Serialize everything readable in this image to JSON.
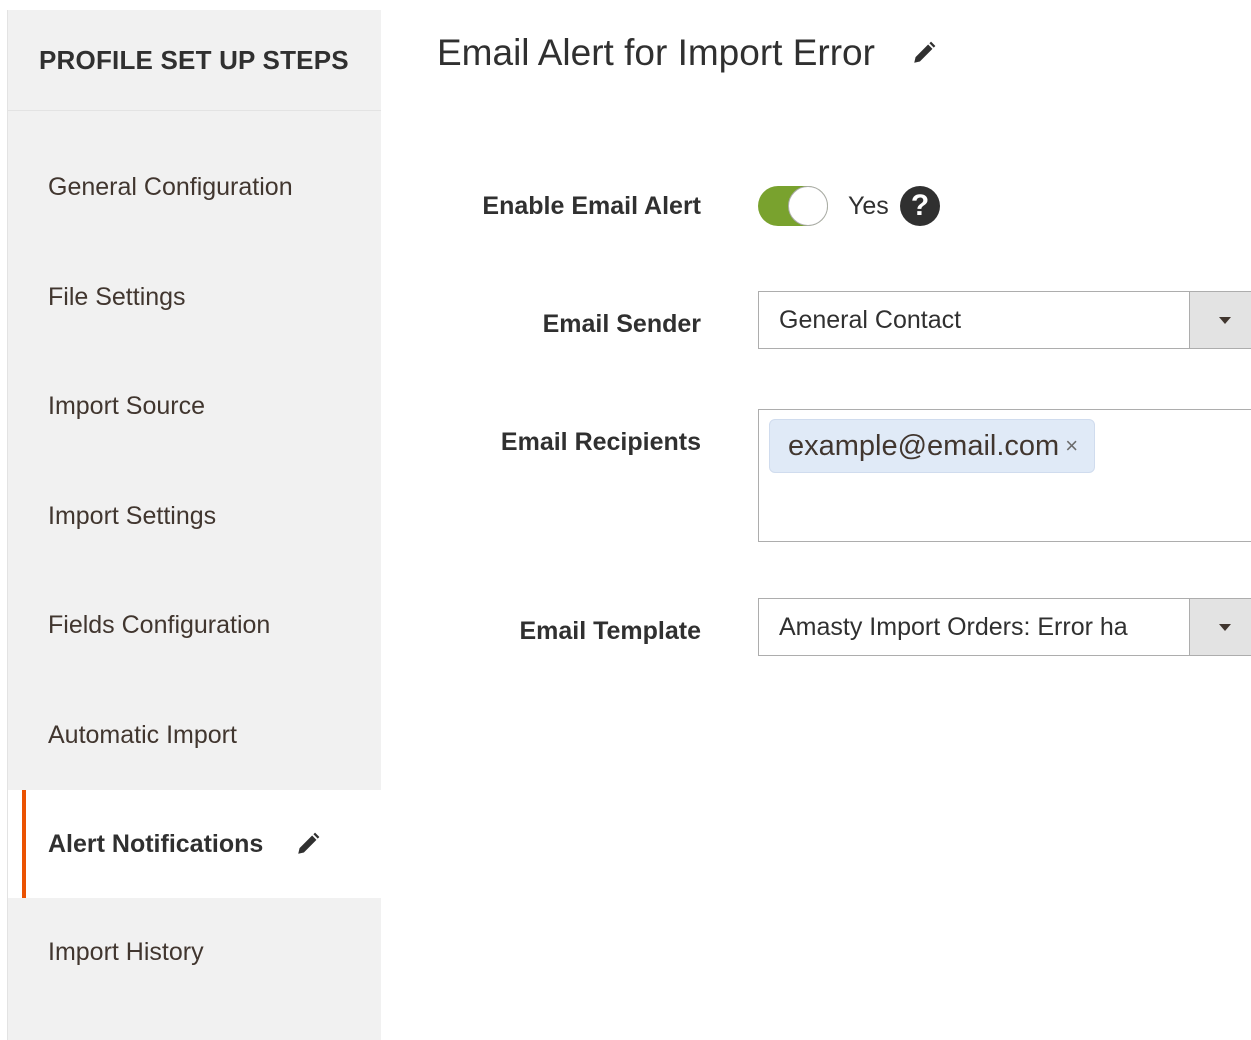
{
  "sidebar": {
    "title": "PROFILE SET UP STEPS",
    "items": [
      {
        "label": "General Configuration"
      },
      {
        "label": "File Settings"
      },
      {
        "label": "Import Source"
      },
      {
        "label": "Import Settings"
      },
      {
        "label": "Fields Configuration"
      },
      {
        "label": "Automatic Import"
      },
      {
        "label": "Alert Notifications",
        "active": true
      },
      {
        "label": "Import History"
      }
    ]
  },
  "main": {
    "title": "Email Alert for Import Error",
    "enable_alert": {
      "label": "Enable Email Alert",
      "value": "Yes",
      "enabled": true
    },
    "sender": {
      "label": "Email Sender",
      "value": "General Contact"
    },
    "recipients": {
      "label": "Email Recipients",
      "tags": [
        "example@email.com"
      ],
      "remove_glyph": "×"
    },
    "template": {
      "label": "Email Template",
      "value": "Amasty Import Orders: Error ha"
    }
  },
  "icons": {
    "edit": "pencil-icon",
    "help": "question-circle-icon",
    "dropdown": "caret-down-icon"
  },
  "colors": {
    "accent": "#eb5202",
    "toggle_on": "#79a22e",
    "tag_bg": "#e0eaf7",
    "sidebar_bg": "#f1f1f1"
  },
  "help_glyph": "?"
}
